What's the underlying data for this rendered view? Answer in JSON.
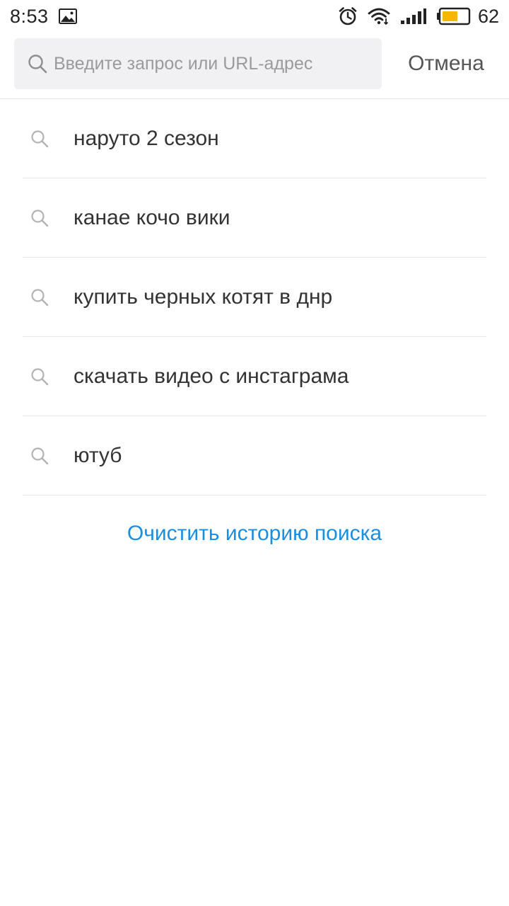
{
  "status_bar": {
    "time": "8:53",
    "battery_level": "62",
    "icons": [
      "gallery-icon",
      "alarm-icon",
      "wifi-icon",
      "signal-icon",
      "battery-icon"
    ],
    "battery_color": "#f5b800"
  },
  "search": {
    "placeholder": "Введите запрос или URL-адрес",
    "value": "",
    "cancel_label": "Отмена"
  },
  "history": {
    "items": [
      {
        "label": "наруто 2 сезон",
        "icon": "search-icon"
      },
      {
        "label": "канае кочо вики",
        "icon": "search-icon"
      },
      {
        "label": "купить черных котят в днр",
        "icon": "search-icon"
      },
      {
        "label": "скачать видео с инстаграма",
        "icon": "search-icon"
      },
      {
        "label": "ютуб",
        "icon": "search-icon"
      }
    ],
    "clear_label": "Очистить историю поиска"
  },
  "colors": {
    "accent": "#1a8fe0",
    "text": "#333333",
    "placeholder": "#9a9a9a",
    "search_box_bg": "#f1f1f3"
  }
}
